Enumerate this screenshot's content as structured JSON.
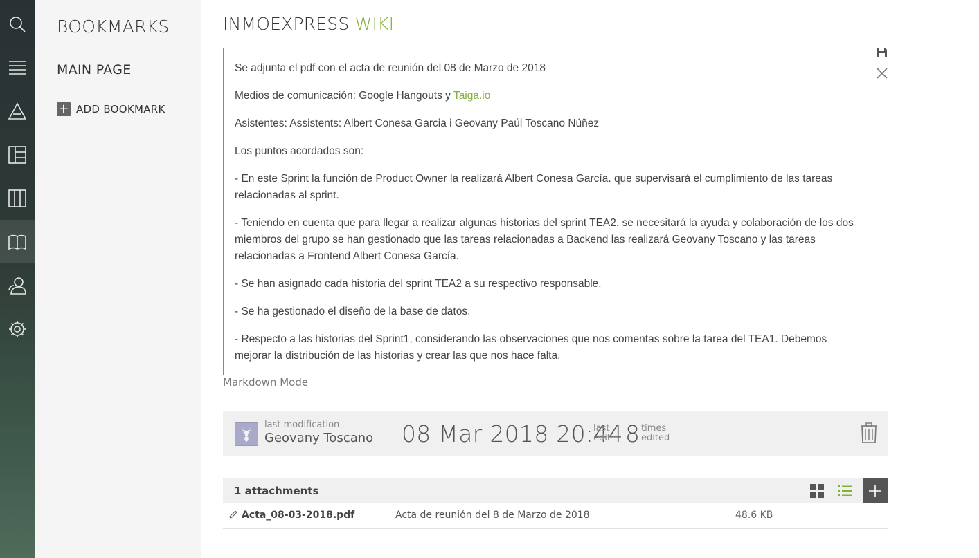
{
  "nav": {
    "icons": [
      "search-icon",
      "menu-icon",
      "timeline-icon",
      "kanban-icon",
      "columns-icon",
      "wiki-book-icon",
      "team-icon",
      "settings-icon"
    ],
    "active": "wiki-book-icon"
  },
  "bookmarks": {
    "title": "BOOKMARKS",
    "main_page": "MAIN PAGE",
    "add_label": "ADD BOOKMARK",
    "add_icon": "+"
  },
  "wiki": {
    "title_part1": "INMOEXPRESS",
    "title_part2": "WIKI",
    "accent_color": "#83b135"
  },
  "editor": {
    "p1": "Se adjunta el pdf con el  acta de reunión del 08 de Marzo de 2018",
    "p2_prefix": "Medios de comunicación: Google Hangouts y ",
    "p2_link": "Taiga.io",
    "p3": "Asistentes: Assistents: Albert Conesa Garcia i Geovany Paúl Toscano Núñez",
    "p4": "Los puntos acordados son:",
    "p5": "- En este Sprint la función de Product Owner la realizará Albert Conesa García. que supervisará el cumplimiento de las tareas relacionadas al sprint.",
    "p6": "- Teniendo en cuenta que para llegar a realizar algunas historias del sprint TEA2, se necesitará la ayuda y colaboración de los dos miembros del grupo se han gestionado que las tareas relacionadas a Backend las realizará Geovany Toscano y las tareas relacionadas a Frontend Albert Conesa García.",
    "p7": "- Se han asignado cada historia del sprint TEA2 a su respectivo responsable.",
    "p8": "- Se ha gestionado el diseño de la base de datos.",
    "p9": "- Respecto a las historias del Sprint1, considerando las observaciones que nos comentas sobre la tarea del TEA1. Debemos mejorar la distribución de las historias y crear las que nos hace falta."
  },
  "markdown_mode": "Markdown Mode",
  "modification": {
    "label": "last modification",
    "user": "Geovany Toscano",
    "date": "08 Mar 2018 20:44",
    "last_edit_1": "last",
    "last_edit_2": "edit",
    "count": "8",
    "times_1": "times",
    "times_2": "edited"
  },
  "attachments": {
    "header": "1 attachments",
    "rows": [
      {
        "name": "Acta_08-03-2018.pdf",
        "description": "Acta de reunión del 8 de Marzo de 2018",
        "size": "48.6 KB"
      }
    ],
    "list_icon_color": "#83b135"
  }
}
